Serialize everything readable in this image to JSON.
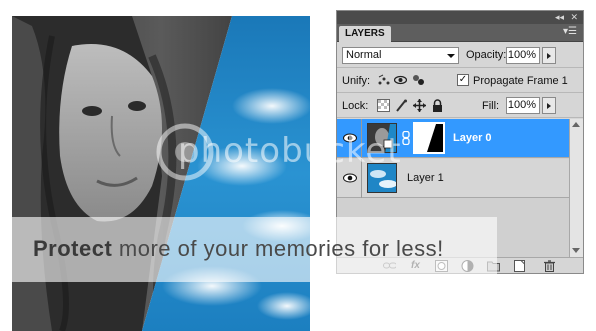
{
  "panel": {
    "tab_label": "LAYERS",
    "collapse_icon": "double-chevron-icon",
    "close_icon": "close-icon",
    "menu_icon": "panel-menu-icon",
    "blend_mode": "Normal",
    "opacity_label": "Opacity:",
    "opacity_value": "100%",
    "unify_label": "Unify:",
    "unify_icons": [
      "unify-position-icon",
      "unify-visibility-icon",
      "unify-style-icon"
    ],
    "propagate_checked": true,
    "propagate_label": "Propagate Frame 1",
    "lock_label": "Lock:",
    "lock_icons": [
      "lock-transparent-icon",
      "lock-image-icon",
      "lock-position-icon",
      "lock-all-icon"
    ],
    "fill_label": "Fill:",
    "fill_value": "100%",
    "layers": [
      {
        "name": "Layer 0",
        "selected": true,
        "visible": true,
        "has_mask": true
      },
      {
        "name": "Layer 1",
        "selected": false,
        "visible": true,
        "has_mask": false
      }
    ],
    "footer_icons": [
      "link-layers-icon",
      "fx-icon",
      "add-mask-icon",
      "adjustment-layer-icon",
      "group-icon",
      "new-layer-icon",
      "trash-icon"
    ]
  },
  "watermark": {
    "logo_text": "photobucket",
    "band_text_1": "Protect ",
    "band_text_2": "more of your memories ",
    "band_text_3": "for less!"
  },
  "colors": {
    "selection": "#3399ff",
    "panel_bg": "#d6d6d6",
    "sky": "#1e88c8"
  }
}
